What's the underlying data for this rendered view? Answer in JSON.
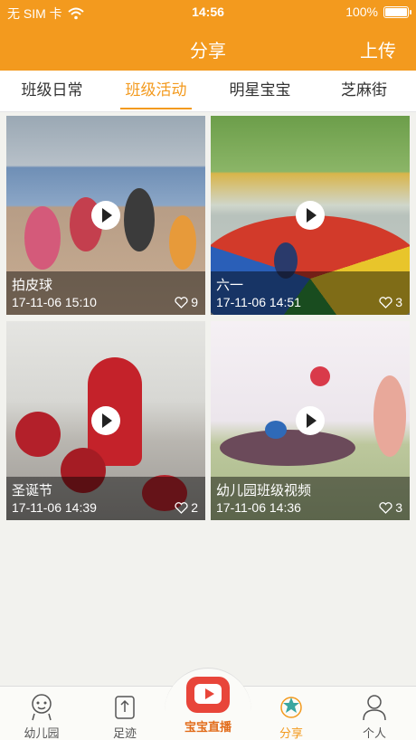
{
  "status": {
    "carrier": "无 SIM 卡",
    "time": "14:56",
    "battery": "100%"
  },
  "nav": {
    "title": "分享",
    "upload": "上传"
  },
  "tabs": [
    {
      "label": "班级日常"
    },
    {
      "label": "班级活动"
    },
    {
      "label": "明星宝宝"
    },
    {
      "label": "芝麻街"
    }
  ],
  "videos": [
    {
      "title": "拍皮球",
      "date": "17-11-06 15:10",
      "likes": "9"
    },
    {
      "title": "六一",
      "date": "17-11-06 14:51",
      "likes": "3"
    },
    {
      "title": "圣诞节",
      "date": "17-11-06 14:39",
      "likes": "2"
    },
    {
      "title": "幼儿园班级视频",
      "date": "17-11-06 14:36",
      "likes": "3"
    }
  ],
  "tabbar": {
    "items": [
      {
        "label": "幼儿园",
        "icon": "kindergarten-icon"
      },
      {
        "label": "足迹",
        "icon": "footprint-icon"
      },
      {
        "label": "宝宝直播",
        "icon": "live-tv-icon"
      },
      {
        "label": "分享",
        "icon": "share-icon"
      },
      {
        "label": "个人",
        "icon": "person-icon"
      }
    ]
  },
  "colors": {
    "accent": "#f39a1e",
    "live": "#e8453a"
  }
}
